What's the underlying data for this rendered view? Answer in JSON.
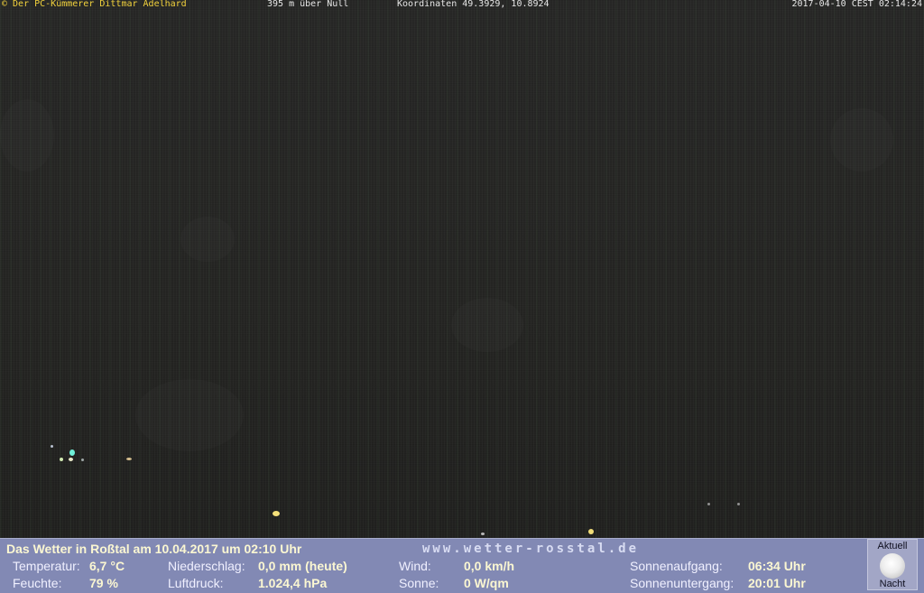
{
  "header": {
    "copyright": "© Der PC-Kümmerer Dittmar Adelhard",
    "altitude": "395 m über Null",
    "coordinates": "Koordinaten 49.3929, 10.8924",
    "timestamp": "2017-04-10 CEST 02:14:24"
  },
  "panel": {
    "title": "Das Wetter in Roßtal am 10.04.2017 um 02:10 Uhr",
    "website": "www.wetter-rosstal.de",
    "temperature_label": "Temperatur:",
    "temperature_value": "6,7 °C",
    "humidity_label": "Feuchte:",
    "humidity_value": "79 %",
    "precip_label": "Niederschlag:",
    "precip_value": "0,0 mm (heute)",
    "pressure_label": "Luftdruck:",
    "pressure_value": "1.024,4 hPa",
    "wind_label": "Wind:",
    "wind_value": "0,0 km/h",
    "sun_label": "Sonne:",
    "sun_value": "0 W/qm",
    "sunrise_label": "Sonnenaufgang:",
    "sunrise_value": "06:34 Uhr",
    "sunset_label": "Sonnenuntergang:",
    "sunset_value": "20:01 Uhr",
    "moon_top": "Aktuell",
    "moon_bottom": "Nacht",
    "moon_icon": "moon-icon"
  }
}
